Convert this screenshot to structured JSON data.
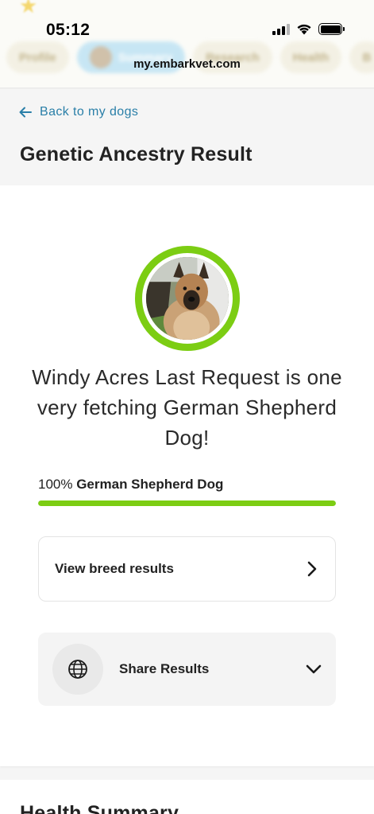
{
  "status_bar": {
    "time": "05:12"
  },
  "browser": {
    "url": "my.embarkvet.com"
  },
  "top_nav": {
    "tabs": [
      {
        "label": "Profile"
      },
      {
        "label": "Summary"
      },
      {
        "label": "Research"
      },
      {
        "label": "Health"
      },
      {
        "label": "B"
      }
    ]
  },
  "header": {
    "back_label": "Back to my dogs",
    "title": "Genetic Ancestry Result"
  },
  "result": {
    "headline": "Windy Acres Last Request is one very fetching German Shepherd Dog!",
    "breed_percent": "100%",
    "breed_name": "German Shepherd Dog",
    "breed_fraction": 1.0,
    "view_breed_label": "View breed results",
    "share_label": "Share Results"
  },
  "next_section": {
    "title": "Health Summary"
  },
  "colors": {
    "accent_green": "#7ccd13",
    "link_blue": "#2a7fa8"
  },
  "icons": {
    "back": "arrow-left-icon",
    "view_breed": "chevron-right-icon",
    "share": "globe-icon",
    "share_toggle": "chevron-down-icon"
  }
}
